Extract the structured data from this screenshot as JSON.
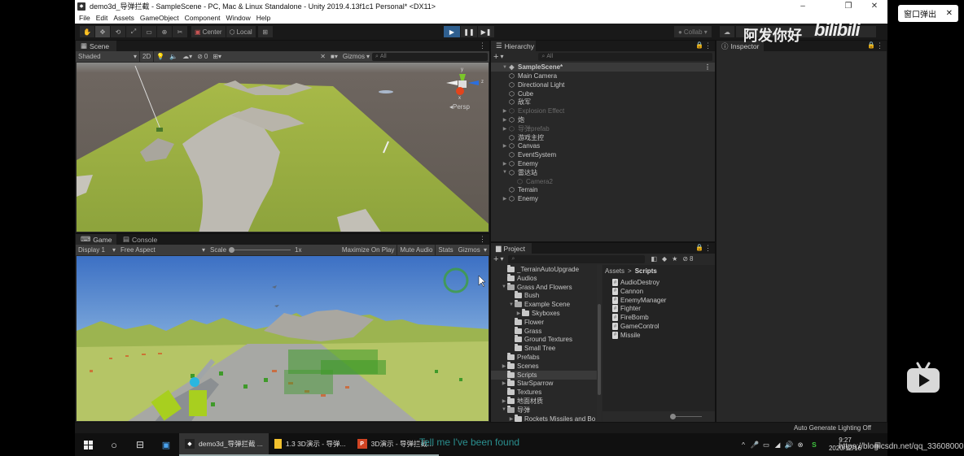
{
  "window": {
    "title": "demo3d_导弹拦截 - SampleScene - PC, Mac & Linux Standalone - Unity 2019.4.13f1c1 Personal* <DX11>",
    "controls": {
      "minimize": "–",
      "maximize": "❐",
      "close": "✕"
    }
  },
  "menu": [
    "File",
    "Edit",
    "Assets",
    "GameObject",
    "Component",
    "Window",
    "Help"
  ],
  "toolbar": {
    "tools": [
      "hand-tool",
      "move-tool",
      "rotate-tool",
      "scale-tool",
      "rect-tool",
      "transform-tool",
      "custom-tool"
    ],
    "tool_glyphs": [
      "✋",
      "✥",
      "⟲",
      "⤢",
      "▭",
      "⊕",
      "✂"
    ],
    "pivot": "Center",
    "space": "Local",
    "play_glyphs": [
      "▶",
      "❚❚",
      "▶❚"
    ],
    "collab": "Collab ▾",
    "account_glyph": "☁"
  },
  "scene_panel": {
    "tab": "Scene",
    "shading": "Shaded",
    "mode_2d": "2D",
    "hidden_count": "0",
    "gizmos": "Gizmos",
    "search_placeholder": "All",
    "persp": "Persp",
    "axes": {
      "y": "y",
      "z": "z",
      "x": "x"
    }
  },
  "game_panel": {
    "tabs": [
      "Game",
      "Console"
    ],
    "display": "Display 1",
    "aspect": "Free Aspect",
    "scale_label": "Scale",
    "scale_value": "1x",
    "buttons": [
      "Maximize On Play",
      "Mute Audio",
      "Stats",
      "Gizmos"
    ]
  },
  "hierarchy": {
    "tab": "Hierarchy",
    "search_placeholder": "All",
    "scene": "SampleScene*",
    "items": [
      {
        "label": "Main Camera",
        "arrow": "",
        "dim": false,
        "indent": 1
      },
      {
        "label": "Directional Light",
        "arrow": "",
        "dim": false,
        "indent": 1
      },
      {
        "label": "Cube",
        "arrow": "",
        "dim": false,
        "indent": 1
      },
      {
        "label": "敌军",
        "arrow": "",
        "dim": false,
        "indent": 1
      },
      {
        "label": "Explosion Effect",
        "arrow": "▶",
        "dim": true,
        "indent": 1
      },
      {
        "label": "炮",
        "arrow": "▶",
        "dim": false,
        "indent": 1
      },
      {
        "label": "导弹prefab",
        "arrow": "▶",
        "dim": true,
        "indent": 1
      },
      {
        "label": "游戏主控",
        "arrow": "",
        "dim": false,
        "indent": 1
      },
      {
        "label": "Canvas",
        "arrow": "▶",
        "dim": false,
        "indent": 1
      },
      {
        "label": "EventSystem",
        "arrow": "",
        "dim": false,
        "indent": 1
      },
      {
        "label": "Enemy",
        "arrow": "▶",
        "dim": false,
        "indent": 1
      },
      {
        "label": "雷达站",
        "arrow": "▼",
        "dim": false,
        "indent": 1
      },
      {
        "label": "Camera2",
        "arrow": "",
        "dim": true,
        "indent": 2
      },
      {
        "label": "Terrain",
        "arrow": "",
        "dim": false,
        "indent": 1
      },
      {
        "label": "Enemy",
        "arrow": "▶",
        "dim": false,
        "indent": 1
      }
    ]
  },
  "inspector": {
    "tab": "Inspector"
  },
  "project": {
    "tab": "Project",
    "hidden_count": "8",
    "breadcrumb": [
      "Assets",
      "Scripts"
    ],
    "folders": [
      {
        "label": "_TerrainAutoUpgrade",
        "arrow": "",
        "indent": 1,
        "open": false
      },
      {
        "label": "Audios",
        "arrow": "",
        "indent": 1,
        "open": false
      },
      {
        "label": "Grass And Flowers",
        "arrow": "▼",
        "indent": 1,
        "open": true
      },
      {
        "label": "Bush",
        "arrow": "",
        "indent": 2,
        "open": false
      },
      {
        "label": "Example Scene",
        "arrow": "▼",
        "indent": 2,
        "open": true
      },
      {
        "label": "Skyboxes",
        "arrow": "▶",
        "indent": 3,
        "open": false
      },
      {
        "label": "Flower",
        "arrow": "",
        "indent": 2,
        "open": false
      },
      {
        "label": "Grass",
        "arrow": "",
        "indent": 2,
        "open": false
      },
      {
        "label": "Ground Textures",
        "arrow": "",
        "indent": 2,
        "open": false
      },
      {
        "label": "Small Tree",
        "arrow": "",
        "indent": 2,
        "open": false
      },
      {
        "label": "Prefabs",
        "arrow": "",
        "indent": 1,
        "open": false
      },
      {
        "label": "Scenes",
        "arrow": "▶",
        "indent": 1,
        "open": false
      },
      {
        "label": "Scripts",
        "arrow": "",
        "indent": 1,
        "open": false,
        "selected": true
      },
      {
        "label": "StarSparrow",
        "arrow": "▶",
        "indent": 1,
        "open": false
      },
      {
        "label": "Textures",
        "arrow": "",
        "indent": 1,
        "open": false
      },
      {
        "label": "地面材质",
        "arrow": "▶",
        "indent": 1,
        "open": false
      },
      {
        "label": "导弹",
        "arrow": "▼",
        "indent": 1,
        "open": true
      },
      {
        "label": "Rockets Missiles and Bo",
        "arrow": "▶",
        "indent": 2,
        "open": false
      }
    ],
    "scripts": [
      "AudioDestroy",
      "Cannon",
      "EnemyManager",
      "Fighter",
      "FireBomb",
      "GameControl",
      "Missile"
    ]
  },
  "status": {
    "lighting": "Auto Generate Lighting Off"
  },
  "taskbar": {
    "apps": [
      {
        "label": "demo3d_导弹拦截 ...",
        "icon": "unity-icon"
      },
      {
        "label": "1.3 3D演示 - 导弹...",
        "icon": "folder-icon"
      },
      {
        "label": "3D演示 - 导弹拦截...",
        "icon": "powerpoint-icon"
      }
    ],
    "time": "9:27",
    "date": "2020/12/16"
  },
  "overlays": {
    "popup_label": "窗口弹出",
    "popup_close": "✕",
    "watermark_text": "阿发你好",
    "watermark_logo": "bilibili",
    "subtitle": "Tell me I've been found",
    "url_watermark": "https://blog.csdn.net/qq_33608000"
  }
}
